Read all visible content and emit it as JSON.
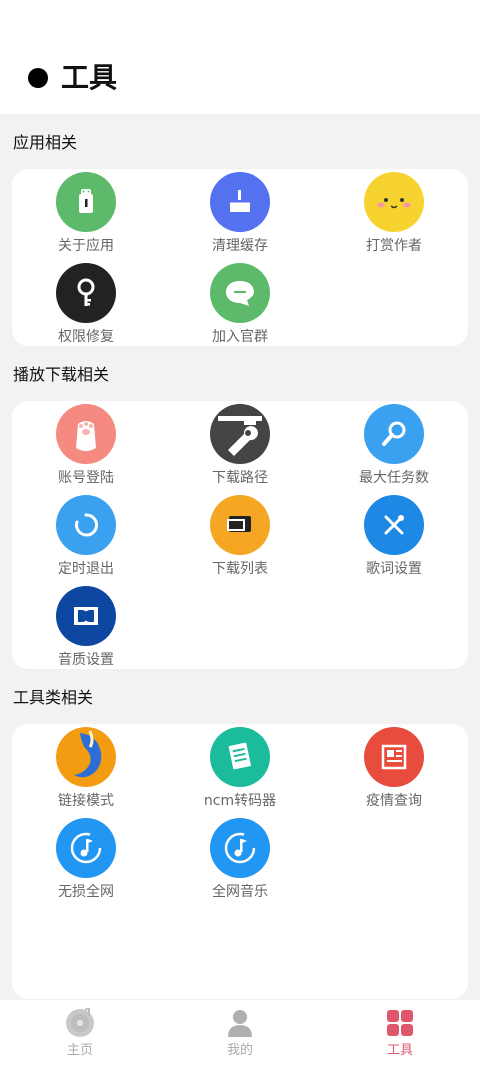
{
  "header": {
    "title": "工具"
  },
  "sections": [
    {
      "title": "应用相关",
      "items": [
        {
          "label": "关于应用",
          "icon": "android-icon",
          "color": "#5dba6a"
        },
        {
          "label": "清理缓存",
          "icon": "broom-icon",
          "color": "#5472f0"
        },
        {
          "label": "打赏作者",
          "icon": "smiley-face-icon",
          "color": "#f7d330"
        },
        {
          "label": "权限修复",
          "icon": "key-icon",
          "color": "#222222"
        },
        {
          "label": "加入官群",
          "icon": "chat-bubble-icon",
          "color": "#5dba6a"
        }
      ]
    },
    {
      "title": "播放下载相关",
      "items": [
        {
          "label": "账号登陆",
          "icon": "paw-icon",
          "color": "#f48a80"
        },
        {
          "label": "下载路径",
          "icon": "wrench-icon",
          "color": "#444444"
        },
        {
          "label": "最大任务数",
          "icon": "spanner-icon",
          "color": "#3aa0f0"
        },
        {
          "label": "定时退出",
          "icon": "timer-icon",
          "color": "#3aa0f0"
        },
        {
          "label": "下载列表",
          "icon": "folder-icon",
          "color": "#f5a623"
        },
        {
          "label": "歌词设置",
          "icon": "tools-icon",
          "color": "#1e88e5"
        },
        {
          "label": "音质设置",
          "icon": "dolby-icon",
          "color": "#0d47a1"
        }
      ]
    },
    {
      "title": "工具类相关",
      "items": [
        {
          "label": "链接模式",
          "icon": "firefox-icon",
          "color": "#f39c12"
        },
        {
          "label": "ncm转码器",
          "icon": "document-icon",
          "color": "#1abc9c"
        },
        {
          "label": "疫情查询",
          "icon": "newspaper-icon",
          "color": "#e74c3c"
        },
        {
          "label": "无损全网",
          "icon": "music-note-icon",
          "color": "#2196f3"
        },
        {
          "label": "全网音乐",
          "icon": "music-note-icon",
          "color": "#2196f3"
        }
      ]
    }
  ],
  "bottom_nav": [
    {
      "label": "主页",
      "icon": "disc-icon"
    },
    {
      "label": "我的",
      "icon": "person-icon"
    },
    {
      "label": "工具",
      "icon": "grid-icon",
      "active": true
    }
  ]
}
